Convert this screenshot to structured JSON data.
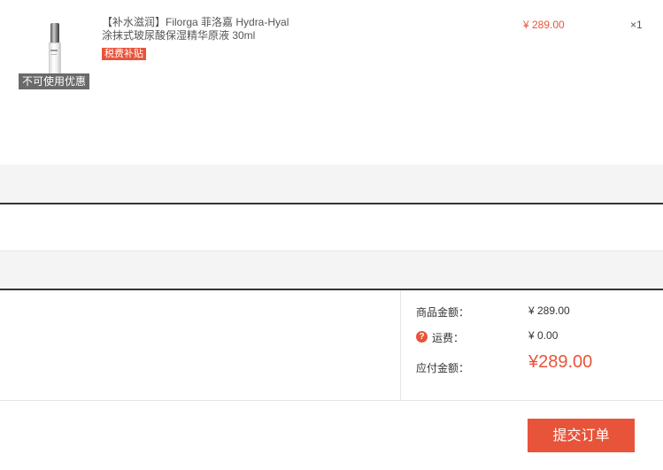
{
  "product": {
    "image_icon": "serum-bottle-image",
    "no_discount_label": "不可使用优惠",
    "name_line1": "【补水滋润】Filorga 菲洛嘉 Hydra-Hyal",
    "name_line2": "涂抹式玻尿酸保湿精华原液 30ml",
    "tax_badge": "税费补贴",
    "price": "¥ 289.00",
    "quantity": "×1"
  },
  "summary": {
    "goods_amount_label": "商品金额：",
    "goods_amount_value": "¥ 289.00",
    "shipping_label": "运费：",
    "shipping_value": "¥ 0.00",
    "shipping_help_icon": "question-icon",
    "payable_label": "应付金额：",
    "payable_value": "¥289.00"
  },
  "actions": {
    "submit_label": "提交订单"
  },
  "colors": {
    "accent": "#e8543a",
    "band": "#f4f4f4"
  }
}
